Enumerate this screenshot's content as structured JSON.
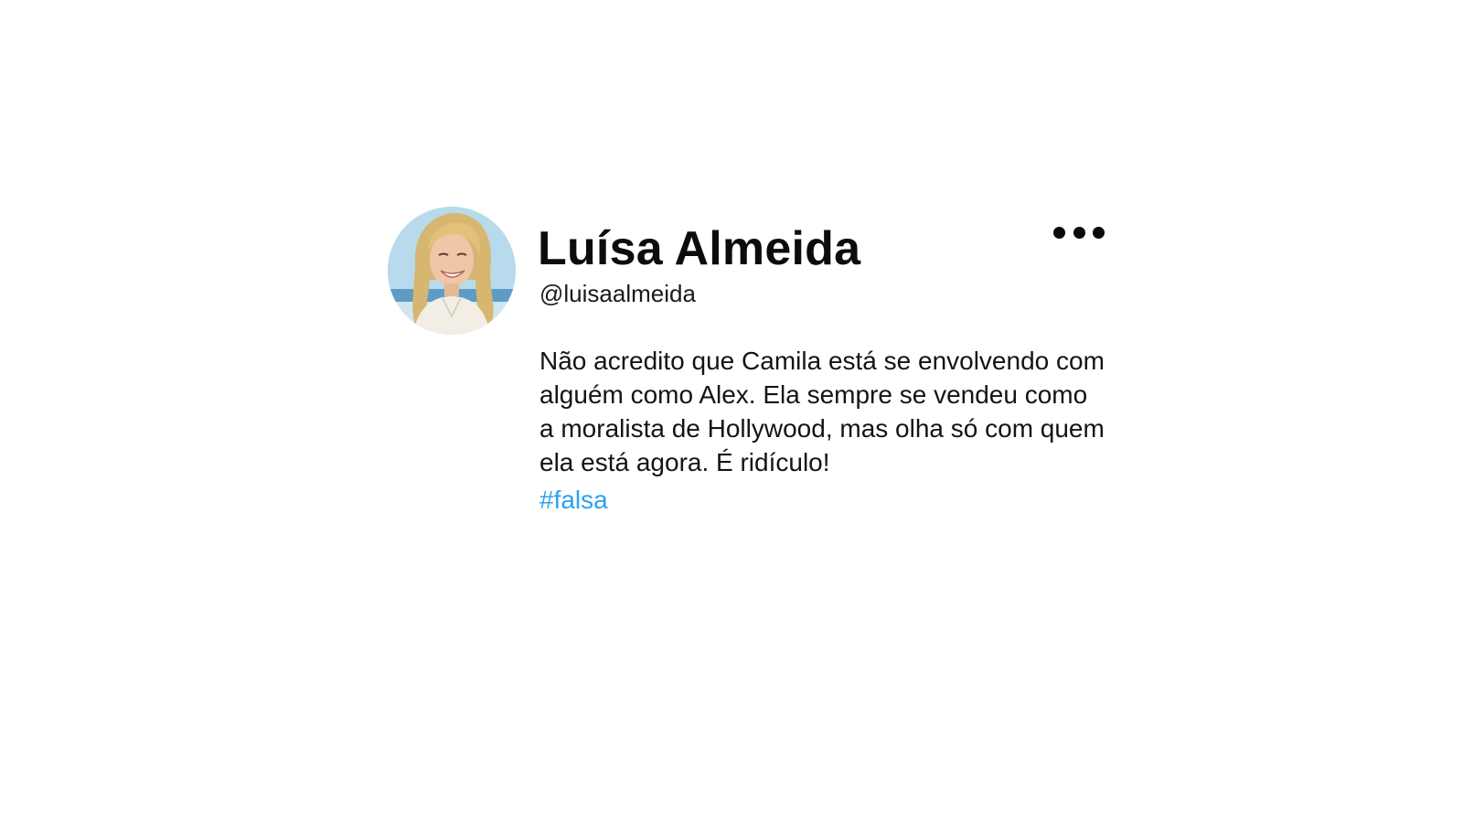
{
  "tweet": {
    "author_name": "Luísa Almeida",
    "handle": "@luisaalmeida",
    "text": "Não acredito que Camila está se envolvendo com alguém como Alex. Ela sempre se vendeu como a moralista de Hollywood, mas olha só com quem ela está agora. É ridículo!",
    "hashtag": "#falsa",
    "avatar_icon": "profile-photo",
    "more_icon": "more-options-icon"
  },
  "colors": {
    "hashtag": "#2aa3ef",
    "text": "#141414",
    "background": "#ffffff"
  }
}
